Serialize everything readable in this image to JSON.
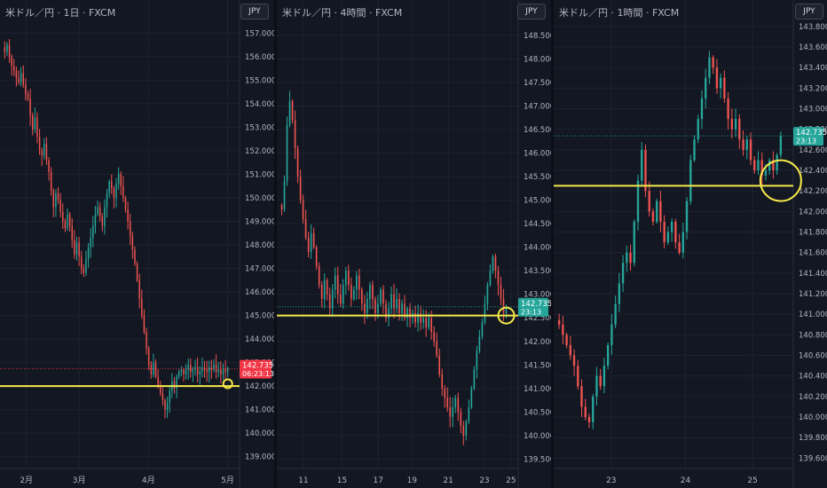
{
  "chart_data": [
    {
      "type": "candlestick",
      "title": "米ドル／円 · 1日 · FXCM",
      "currency": "JPY",
      "ylim": [
        138.5,
        157.5
      ],
      "yticks": [
        "157.000",
        "156.000",
        "155.000",
        "154.000",
        "153.000",
        "152.000",
        "151.000",
        "150.000",
        "149.000",
        "148.000",
        "147.000",
        "146.000",
        "145.000",
        "144.000",
        "143.000",
        "142.000",
        "141.000",
        "140.000",
        "139.000"
      ],
      "xlabels": [
        "2月",
        "3月",
        "4月",
        "5月"
      ],
      "last_price": "142.735",
      "countdown": "06:23:13",
      "price_tag_color": "#f23645",
      "horizontal_line": 142.0,
      "circle_marker": {
        "bar": 96,
        "price": 142.1
      },
      "series": [
        {
          "values": [
            156.2,
            156.5,
            156.0,
            155.6,
            155.4,
            155.1,
            154.9,
            155.3,
            154.8,
            154.4,
            154.2,
            153.5,
            152.9,
            153.4,
            152.6,
            152.0,
            151.8,
            152.3,
            151.6,
            151.1,
            150.3,
            149.6,
            150.2,
            149.9,
            149.4,
            149.0,
            148.7,
            149.3,
            148.8,
            148.2,
            147.6,
            148.1,
            147.5,
            147.0,
            146.8,
            147.4,
            147.9,
            148.3,
            148.8,
            149.3,
            149.6,
            149.2,
            148.8,
            149.6,
            150.2,
            150.7,
            150.4,
            150.0,
            150.6,
            151.0,
            150.5,
            150.0,
            149.5,
            149.0,
            148.4,
            147.8,
            147.2,
            146.5,
            145.7,
            145.0,
            144.3,
            143.6,
            142.9,
            142.5,
            143.0,
            142.4,
            142.0,
            141.7,
            141.4,
            141.0,
            141.3,
            141.8,
            142.2,
            141.9,
            142.4,
            142.6,
            142.7,
            142.5,
            142.7,
            142.9,
            142.6,
            142.7,
            142.8,
            142.5,
            142.6,
            142.8,
            142.7,
            142.6,
            142.8,
            142.7,
            142.9,
            142.6,
            142.7,
            142.5,
            142.7,
            142.6,
            142.735
          ]
        }
      ]
    },
    {
      "type": "candlestick",
      "title": "米ドル／円 · 4時間 · FXCM",
      "currency": "JPY",
      "ylim": [
        139.3,
        148.8
      ],
      "yticks": [
        "148.500",
        "148.000",
        "147.500",
        "147.000",
        "146.500",
        "146.000",
        "145.500",
        "145.000",
        "144.500",
        "144.000",
        "143.500",
        "143.000",
        "142.500",
        "142.000",
        "141.500",
        "141.000",
        "140.500",
        "140.000",
        "139.500"
      ],
      "xlabels": [
        "11",
        "15",
        "17",
        "19",
        "21",
        "23",
        "25"
      ],
      "last_price": "142.735",
      "countdown": "23:13",
      "price_tag_color": "#26a69a",
      "horizontal_line": 142.55,
      "circle_marker": {
        "bar": 118,
        "price": 142.55
      },
      "series": [
        {
          "values": [
            144.8,
            145.4,
            146.6,
            147.1,
            146.7,
            146.1,
            145.5,
            145.0,
            144.6,
            144.2,
            143.9,
            144.3,
            144.0,
            143.6,
            143.2,
            142.9,
            143.3,
            143.0,
            142.7,
            143.1,
            143.4,
            143.0,
            142.8,
            143.2,
            143.5,
            143.2,
            142.9,
            143.1,
            143.4,
            143.1,
            142.8,
            142.6,
            142.9,
            143.2,
            142.9,
            142.6,
            142.8,
            143.1,
            142.8,
            142.5,
            142.7,
            143.0,
            142.7,
            142.9,
            142.6,
            142.8,
            142.5,
            142.7,
            142.5,
            142.6,
            142.4,
            142.6,
            142.4,
            142.5,
            142.3,
            142.5,
            142.2,
            142.0,
            141.7,
            141.3,
            141.0,
            140.8,
            140.6,
            140.4,
            140.6,
            140.8,
            140.5,
            140.2,
            140.0,
            140.3,
            140.6,
            141.0,
            141.4,
            141.8,
            142.1,
            142.4,
            142.8,
            143.2,
            143.5,
            143.8,
            143.5,
            143.2,
            142.9,
            142.6,
            142.735
          ]
        }
      ]
    },
    {
      "type": "candlestick",
      "title": "米ドル／円 · 1時間 · FXCM",
      "currency": "JPY",
      "ylim": [
        139.5,
        143.85
      ],
      "yticks": [
        "143.800",
        "143.600",
        "143.400",
        "143.200",
        "143.000",
        "142.800",
        "142.600",
        "142.400",
        "142.200",
        "142.000",
        "141.800",
        "141.600",
        "141.400",
        "141.200",
        "141.000",
        "140.800",
        "140.600",
        "140.400",
        "140.200",
        "140.000",
        "139.800",
        "139.600"
      ],
      "xlabels": [
        "23",
        "24",
        "25"
      ],
      "last_price": "142.735",
      "countdown": "23:13",
      "price_tag_color": "#26a69a",
      "horizontal_line": 142.25,
      "circle_marker": {
        "bar": 68,
        "price": 142.3
      },
      "series": [
        {
          "values": [
            140.9,
            140.8,
            140.7,
            140.6,
            140.5,
            140.3,
            140.1,
            140.0,
            139.95,
            140.2,
            140.4,
            140.3,
            140.5,
            140.7,
            140.9,
            141.1,
            141.3,
            141.5,
            141.6,
            141.5,
            141.9,
            142.3,
            142.6,
            142.2,
            142.0,
            141.9,
            142.1,
            141.9,
            141.7,
            141.8,
            141.9,
            141.7,
            141.6,
            141.8,
            142.1,
            142.5,
            142.7,
            142.9,
            143.1,
            143.3,
            143.5,
            143.4,
            143.2,
            143.3,
            143.1,
            142.9,
            142.8,
            142.9,
            142.7,
            142.6,
            142.7,
            142.5,
            142.4,
            142.5,
            142.35,
            142.4,
            142.5,
            142.4,
            142.55,
            142.735
          ]
        }
      ]
    }
  ]
}
